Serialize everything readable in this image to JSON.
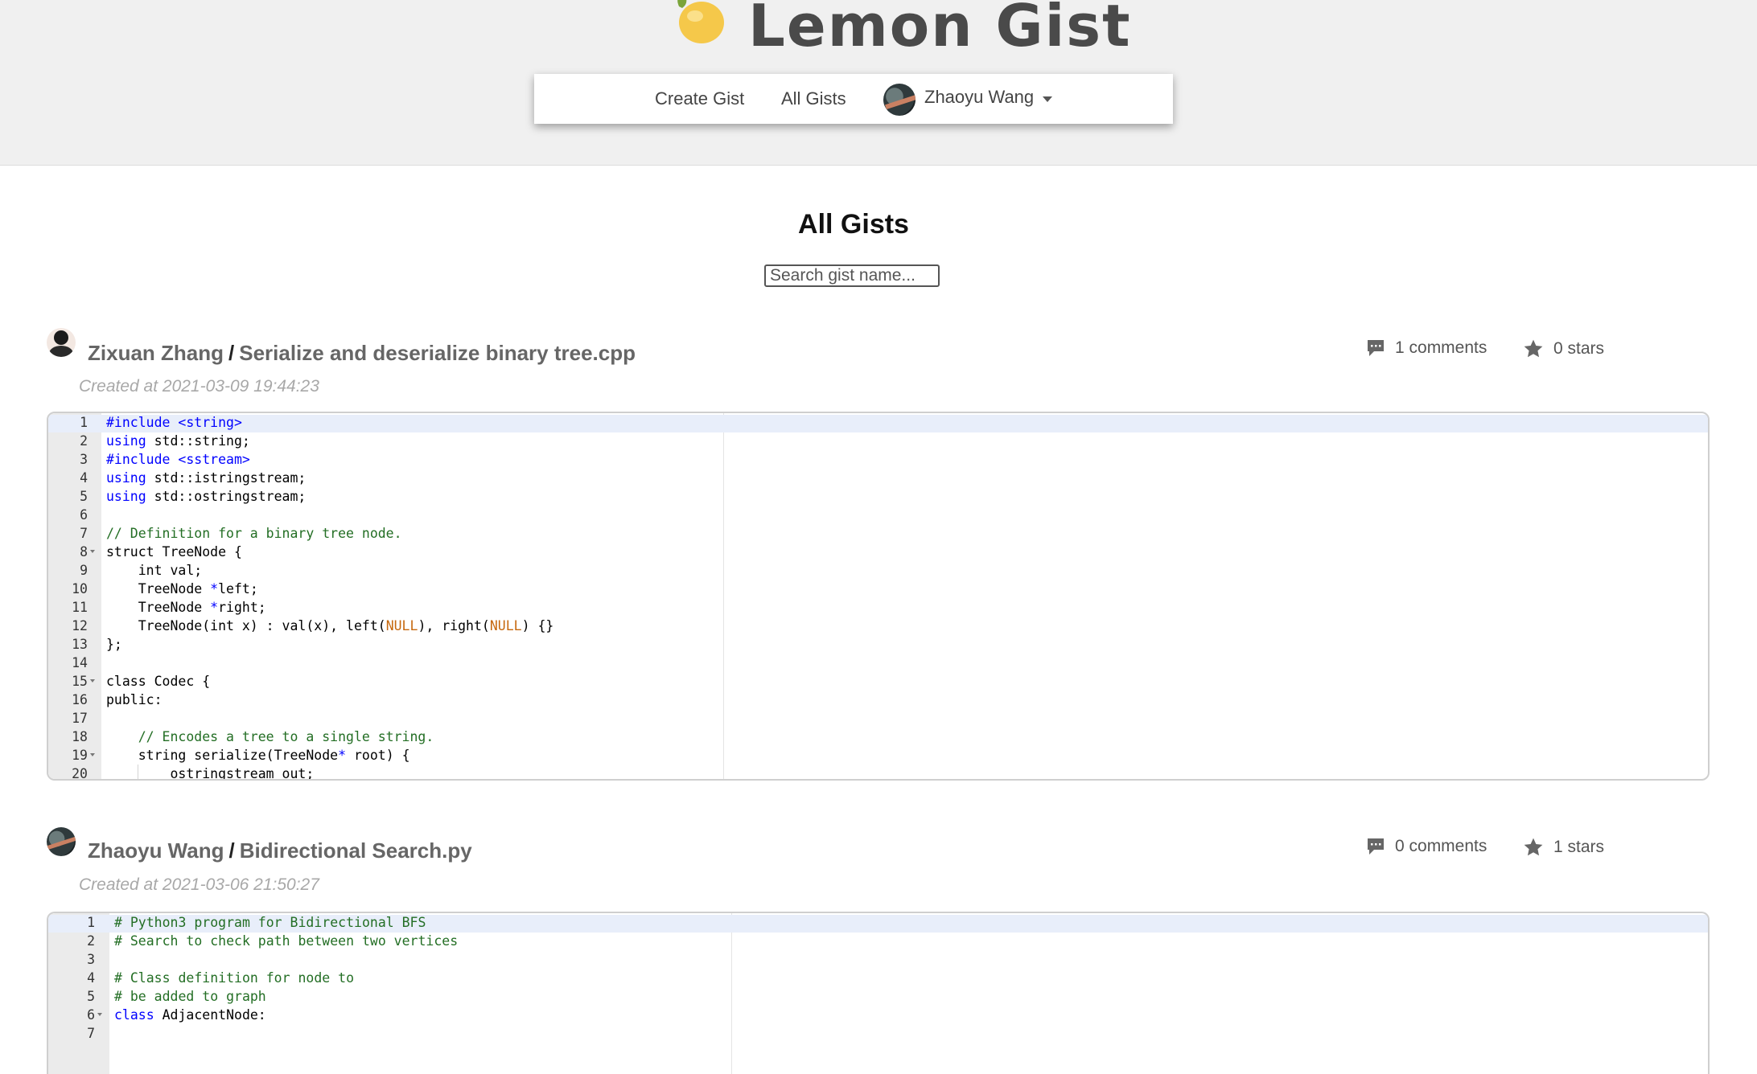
{
  "app": {
    "title": "Lemon Gist"
  },
  "nav": {
    "create_label": "Create Gist",
    "all_label": "All Gists",
    "user_name": "Zhaoyu Wang"
  },
  "main": {
    "title": "All Gists",
    "search_placeholder": "Search gist name..."
  },
  "gists": [
    {
      "author": "Zixuan Zhang",
      "name": "Serialize and deserialize binary tree.cpp",
      "created": "Created at 2021-03-09 19:44:23",
      "comments": "1 comments",
      "stars": "0 stars",
      "line_numbers": [
        "1",
        "2",
        "3",
        "4",
        "5",
        "6",
        "7",
        "8",
        "9",
        "10",
        "11",
        "12",
        "13",
        "14",
        "15",
        "16",
        "17",
        "18",
        "19",
        "20"
      ]
    },
    {
      "author": "Zhaoyu Wang",
      "name": "Bidirectional Search.py",
      "created": "Created at 2021-03-06 21:50:27",
      "comments": "0 comments",
      "stars": "1 stars",
      "line_numbers": [
        "1",
        "2",
        "3",
        "4",
        "5",
        "6",
        "7"
      ]
    }
  ],
  "code1": {
    "l1": "#include <string>",
    "l2_kw": "using",
    "l2": " std::string;",
    "l3": "#include <sstream>",
    "l4_kw": "using",
    "l4": " std::istringstream;",
    "l5_kw": "using",
    "l5": " std::ostringstream;",
    "l7": "// Definition for a binary tree node.",
    "l8": "struct TreeNode {",
    "l9": "    int val;",
    "l10a": "    TreeNode ",
    "l10b": "*",
    "l10c": "left;",
    "l11a": "    TreeNode ",
    "l11b": "*",
    "l11c": "right;",
    "l12a": "    TreeNode(int x) : val(x), left(",
    "l12b": "NULL",
    "l12c": "), right(",
    "l12d": "NULL",
    "l12e": ") {}",
    "l13": "};",
    "l15": "class Codec {",
    "l16": "public:",
    "l18": "    // Encodes a tree to a single string.",
    "l19a": "    string serialize(TreeNode",
    "l19b": "*",
    "l19c": " root) {",
    "l20": "        ostringstream out;"
  },
  "code2": {
    "l1": "# Python3 program for Bidirectional BFS",
    "l2": "# Search to check path between two vertices",
    "l4": "# Class definition for node to",
    "l5": "# be added to graph",
    "l6_kw": "class",
    "l6": " AdjacentNode:"
  },
  "colors": {
    "keyword": "#0000ff",
    "comment": "#236e24",
    "constant": "#c6680e",
    "lemon": "#f5c84a"
  },
  "icons": [
    "lemon-logo-icon",
    "comment-icon",
    "star-icon",
    "caret-down-icon"
  ]
}
